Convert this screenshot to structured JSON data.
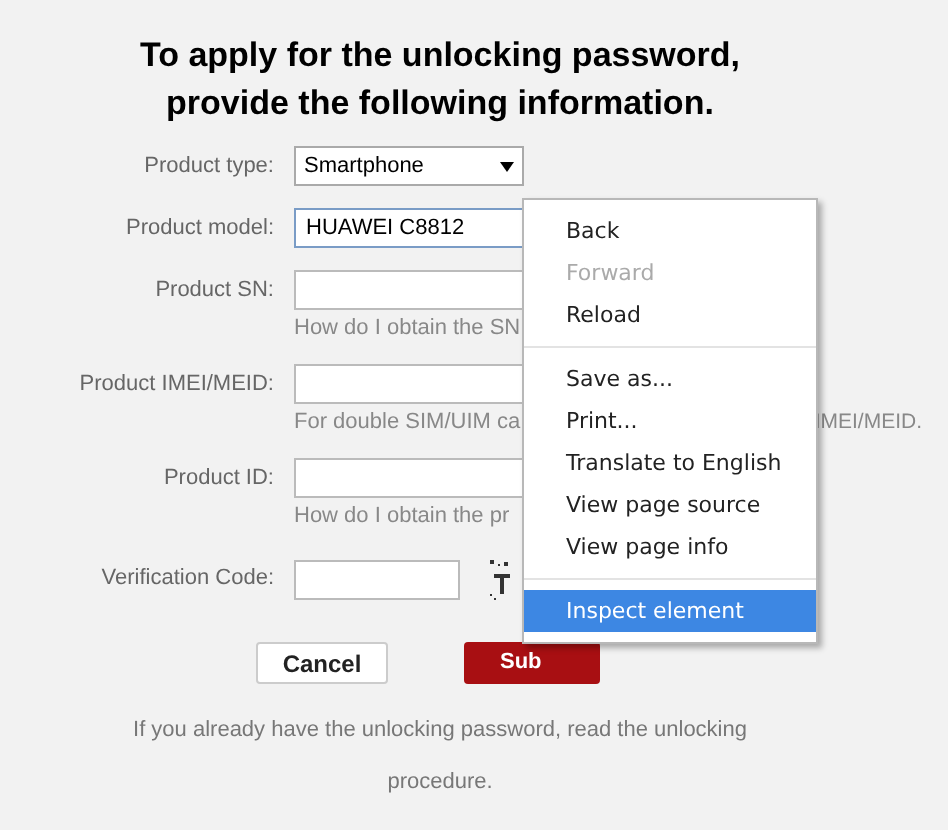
{
  "title": "To apply for the unlocking password, provide the following information.",
  "fields": [
    {
      "label": "Product type:",
      "kind": "select",
      "value": "Smartphone"
    },
    {
      "label": "Product model:",
      "kind": "text",
      "value": "HUAWEI C8812"
    },
    {
      "label": "Product SN:",
      "kind": "text",
      "hint": "How do I obtain the SN"
    },
    {
      "label": "Product IMEI/MEID:",
      "kind": "text",
      "hint": "For double SIM/UIM ca",
      "hint_tail": "IMEI/MEID."
    },
    {
      "label": "Product ID:",
      "kind": "text",
      "hint": "How do I obtain the pr"
    },
    {
      "label": "Verification Code:",
      "kind": "captcha"
    }
  ],
  "buttons": [
    {
      "label": "Cancel",
      "kind": "plain"
    },
    {
      "label": "Sub",
      "kind": "primary"
    }
  ],
  "footer": "If you already have the unlocking password, read the unlocking procedure.",
  "context_menu": [
    {
      "kind": "item",
      "label": "Back",
      "disabled": false,
      "selected": false
    },
    {
      "kind": "item",
      "label": "Forward",
      "disabled": true,
      "selected": false
    },
    {
      "kind": "item",
      "label": "Reload",
      "disabled": false,
      "selected": false
    },
    {
      "kind": "separator"
    },
    {
      "kind": "item",
      "label": "Save as...",
      "disabled": false,
      "selected": false
    },
    {
      "kind": "item",
      "label": "Print...",
      "disabled": false,
      "selected": false
    },
    {
      "kind": "item",
      "label": "Translate to English",
      "disabled": false,
      "selected": false
    },
    {
      "kind": "item",
      "label": "View page source",
      "disabled": false,
      "selected": false
    },
    {
      "kind": "item",
      "label": "View page info",
      "disabled": false,
      "selected": false
    },
    {
      "kind": "separator"
    },
    {
      "kind": "item",
      "label": "Inspect element",
      "disabled": false,
      "selected": true
    }
  ]
}
